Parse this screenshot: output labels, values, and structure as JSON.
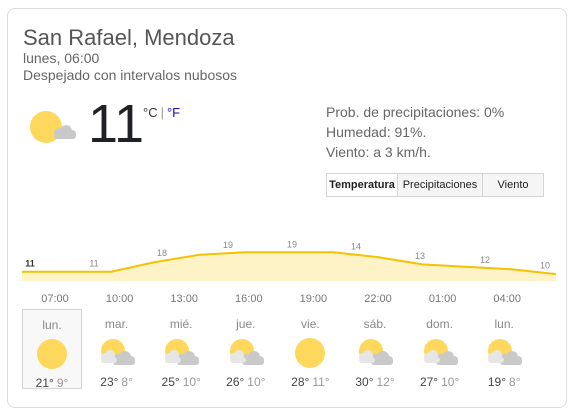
{
  "location": "San Rafael, Mendoza",
  "datetime": "lunes, 06:00",
  "condition": "Despejado con intervalos nubosos",
  "current": {
    "temperature": "11",
    "unit_c": "°C",
    "unit_sep": "|",
    "unit_f": "°F",
    "icon": "partly-sunny-icon"
  },
  "details": {
    "precip": "Prob. de precipitaciones: 0%",
    "humidity": "Humedad: 91%.",
    "wind": "Viento: a 3 km/h."
  },
  "tabs": [
    "Temperatura",
    "Precipitaciones",
    "Viento"
  ],
  "active_tab": "Temperatura",
  "colors": {
    "line": "#f5c100",
    "fill": "#fdf3c7",
    "sun": "#fdd85d",
    "cloud": "#c9c9c9"
  },
  "chart_data": {
    "type": "area",
    "x": [
      "06:00",
      "08:00",
      "10:00",
      "12:00",
      "14:00",
      "16:00",
      "18:00",
      "20:00",
      "22:00",
      "00:00",
      "02:00",
      "04:00",
      "06:00"
    ],
    "values": [
      11,
      11,
      11,
      15,
      18,
      19,
      19,
      19,
      17,
      14,
      13,
      12,
      10
    ],
    "labels": [
      {
        "x": "06:00",
        "label": "11"
      },
      {
        "x": "10:00",
        "label": "11"
      },
      {
        "x": "14:00",
        "label": "18"
      },
      {
        "x": "18:00",
        "label": "19"
      },
      {
        "x": "21:00",
        "label": "19"
      },
      {
        "x": "02:00",
        "label": "14"
      },
      {
        "x": "04:00",
        "label": "13"
      },
      {
        "x": "06:00+",
        "label": "12"
      },
      {
        "x": "end",
        "label": "10"
      }
    ],
    "ylim": [
      0,
      25
    ]
  },
  "hours": [
    "07:00",
    "10:00",
    "13:00",
    "16:00",
    "19:00",
    "22:00",
    "01:00",
    "04:00"
  ],
  "days": [
    {
      "name": "lun.",
      "hi": "21°",
      "lo": "9°",
      "icon": "sun-icon"
    },
    {
      "name": "mar.",
      "hi": "23°",
      "lo": "8°",
      "icon": "partly-cloudy-icon"
    },
    {
      "name": "mié.",
      "hi": "25°",
      "lo": "10°",
      "icon": "partly-cloudy-icon"
    },
    {
      "name": "jue.",
      "hi": "26°",
      "lo": "10°",
      "icon": "partly-cloudy-icon"
    },
    {
      "name": "vie.",
      "hi": "28°",
      "lo": "11°",
      "icon": "sun-icon"
    },
    {
      "name": "sáb.",
      "hi": "30°",
      "lo": "12°",
      "icon": "partly-cloudy-icon"
    },
    {
      "name": "dom.",
      "hi": "27°",
      "lo": "10°",
      "icon": "partly-cloudy-icon"
    },
    {
      "name": "lun.",
      "hi": "19°",
      "lo": "8°",
      "icon": "partly-cloudy-icon"
    }
  ]
}
